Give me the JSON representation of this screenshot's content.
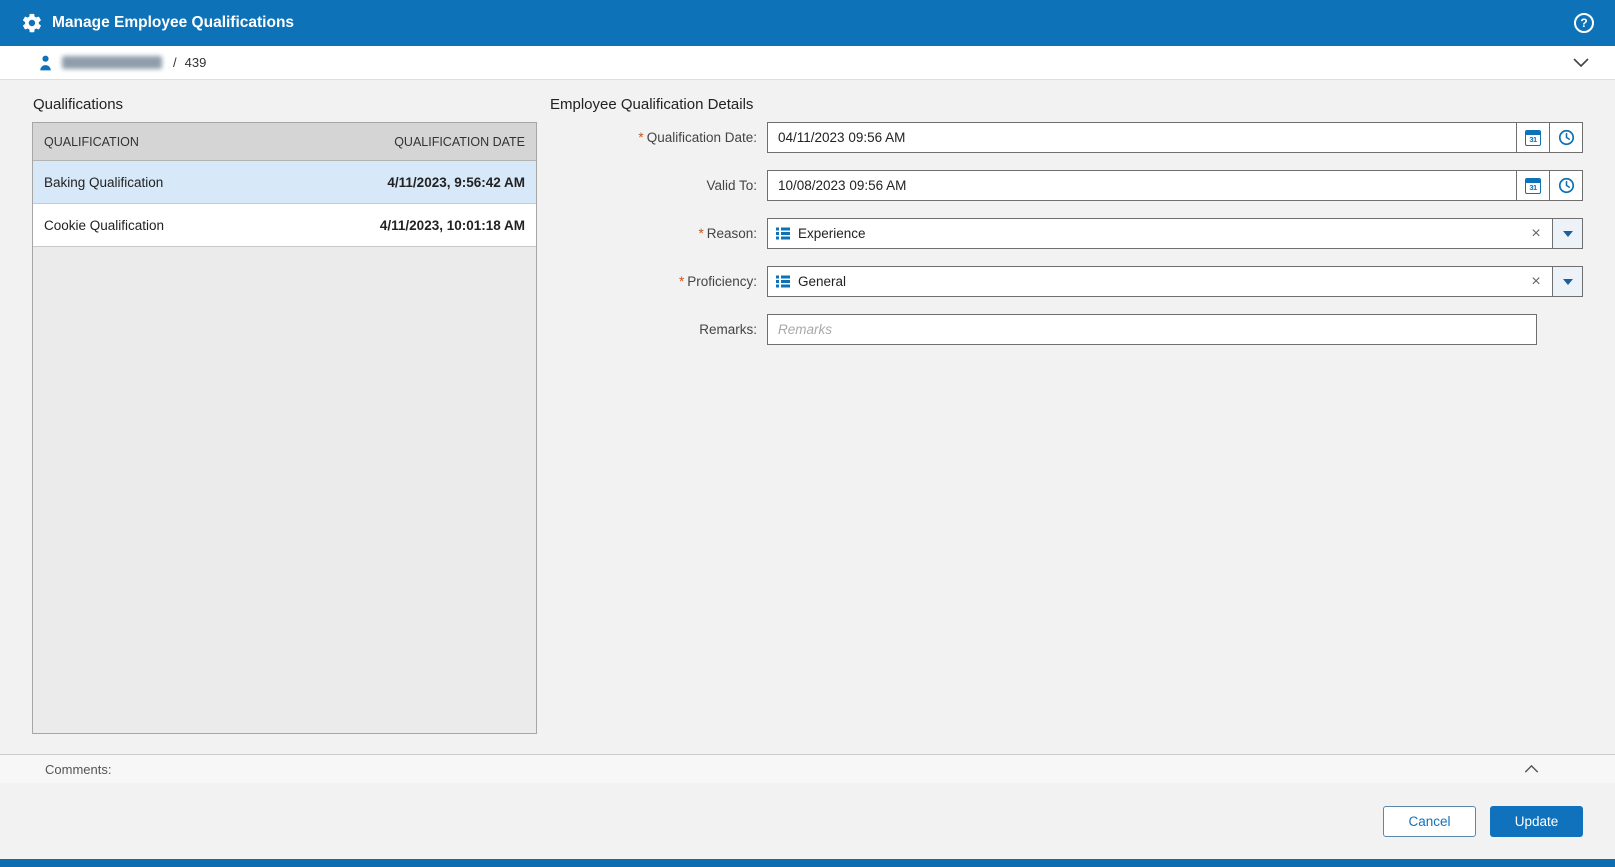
{
  "header": {
    "title": "Manage Employee Qualifications"
  },
  "icons": {
    "gear": "gear-icon",
    "help": "?",
    "person": "person-icon",
    "chevron_down": "chevron-down-icon",
    "chevron_up": "chevron-up-icon",
    "calendar_day": "31",
    "clock": "clock-icon",
    "list": "list-icon",
    "clear": "×"
  },
  "breadcrumb": {
    "separator": "/",
    "employee_id": "439"
  },
  "qualifications": {
    "title": "Qualifications",
    "columns": [
      "QUALIFICATION",
      "QUALIFICATION DATE"
    ],
    "rows": [
      {
        "name": "Baking Qualification",
        "date": "4/11/2023, 9:56:42 AM",
        "selected": true
      },
      {
        "name": "Cookie Qualification",
        "date": "4/11/2023, 10:01:18 AM",
        "selected": false
      }
    ]
  },
  "details": {
    "title": "Employee Qualification Details",
    "required_marker": "*",
    "fields": {
      "qualification_date": {
        "label": "Qualification Date:",
        "required": true,
        "value": "04/11/2023 09:56 AM"
      },
      "valid_to": {
        "label": "Valid To:",
        "required": false,
        "value": "10/08/2023 09:56 AM"
      },
      "reason": {
        "label": "Reason:",
        "required": true,
        "value": "Experience"
      },
      "proficiency": {
        "label": "Proficiency:",
        "required": true,
        "value": "General"
      },
      "remarks": {
        "label": "Remarks:",
        "placeholder": "Remarks",
        "value": ""
      }
    }
  },
  "comments": {
    "label": "Comments:"
  },
  "footer": {
    "cancel_label": "Cancel",
    "update_label": "Update"
  },
  "colors": {
    "header_blue": "#0d72b7",
    "accent_blue": "#1072bc",
    "required_orange": "#c8571c",
    "selected_row": "#d7e8f8",
    "table_header_gray": "#d5d5d5",
    "content_bg": "#f2f2f2"
  }
}
